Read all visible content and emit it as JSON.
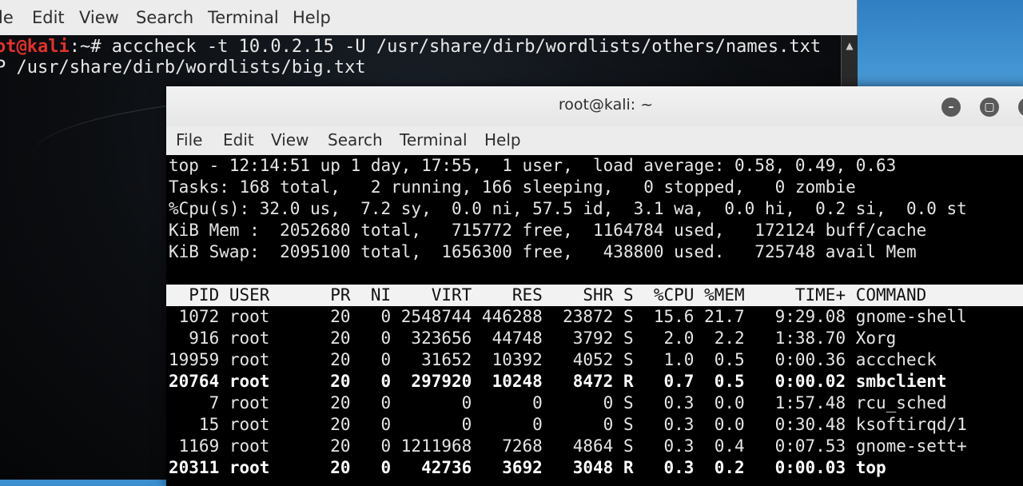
{
  "back_window": {
    "menu": [
      "le",
      "Edit",
      "View",
      "Search",
      "Terminal",
      "Help"
    ],
    "prompt_user": "ot@kali",
    "prompt_rest": ":~# acccheck -t 10.0.2.15 -U /usr/share/dirb/wordlists/others/names.txt",
    "line2": "P /usr/share/dirb/wordlists/big.txt",
    "scroll_arrow": "▲"
  },
  "front_window": {
    "title": "root@kali: ~",
    "buttons": {
      "minimize": "–",
      "maximize": "▢",
      "close": "✕"
    },
    "menu": [
      "File",
      "Edit",
      "View",
      "Search",
      "Terminal",
      "Help"
    ]
  },
  "top": {
    "summary": [
      "top - 12:14:51 up 1 day, 17:55,  1 user,  load average: 0.58, 0.49, 0.63",
      "Tasks: 168 total,   2 running, 166 sleeping,   0 stopped,   0 zombie",
      "%Cpu(s): 32.0 us,  7.2 sy,  0.0 ni, 57.5 id,  3.1 wa,  0.0 hi,  0.2 si,  0.0 st",
      "KiB Mem :  2052680 total,   715772 free,  1164784 used,   172124 buff/cache",
      "KiB Swap:  2095100 total,  1656300 free,   438800 used.   725748 avail Mem"
    ],
    "header": "  PID USER      PR  NI    VIRT    RES    SHR S  %CPU %MEM     TIME+ COMMAND",
    "processes": [
      {
        "text": " 1072 root      20   0 2548744 446288  23872 S  15.6 21.7   9:29.08 gnome-shell",
        "bold": false
      },
      {
        "text": "  916 root      20   0  323656  44748   3792 S   2.0  2.2   1:38.70 Xorg",
        "bold": false
      },
      {
        "text": "19959 root      20   0   31652  10392   4052 S   1.0  0.5   0:00.36 acccheck",
        "bold": false
      },
      {
        "text": "20764 root      20   0  297920  10248   8472 R   0.7  0.5   0:00.02 smbclient",
        "bold": true
      },
      {
        "text": "    7 root      20   0       0      0      0 S   0.3  0.0   1:57.48 rcu_sched",
        "bold": false
      },
      {
        "text": "   15 root      20   0       0      0      0 S   0.3  0.0   0:30.48 ksoftirqd/1",
        "bold": false
      },
      {
        "text": " 1169 root      20   0 1211968   7268   4864 S   0.3  0.4   0:07.53 gnome-sett+",
        "bold": false
      },
      {
        "text": "20311 root      20   0   42736   3692   3048 R   0.3  0.2   0:00.03 top",
        "bold": true
      }
    ]
  }
}
